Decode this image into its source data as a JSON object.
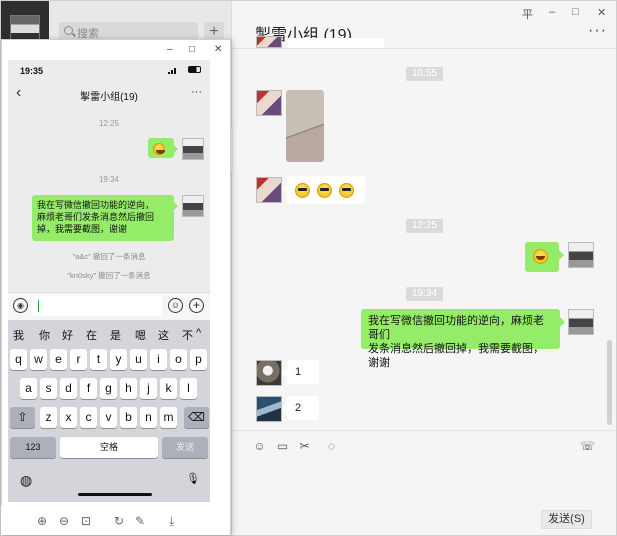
{
  "desktop": {
    "search_placeholder": "搜索",
    "add_label": "+",
    "chat_title": "掣雷小组 (19)",
    "titlebar": {
      "pin": "平",
      "min": "–",
      "max": "□",
      "close": "✕"
    },
    "more": "···",
    "times": [
      "10:55",
      "12:25",
      "19:34"
    ],
    "messages": {
      "emoji_row": "3 cool emoji",
      "right_text": "我在写微信撤回功能的逆向，麻烦老哥们发条消息然后撤回掉，我需要截图，谢谢",
      "right_line1": "我在写微信撤回功能的逆向，麻烦老哥们",
      "right_line2": "发条消息然后撤回掉，我需要截图，谢谢",
      "reply1": "1",
      "reply2": "2"
    },
    "tools": {
      "emoji": "☺",
      "folder": "▭",
      "scissors": "✂",
      "chat": "◌",
      "video": "☏"
    },
    "send_label": "发送(S)"
  },
  "phone": {
    "window_controls": {
      "min": "–",
      "max": "□",
      "close": "✕"
    },
    "status_time": "19:35",
    "back": "‹",
    "chat_title": "掣雷小组(19)",
    "more": "···",
    "time1": "12:25",
    "time2": "19:34",
    "bubble_text_line1": "我在写微信撤回功能的逆向，",
    "bubble_text_line2": "麻烦老哥们发条消息然后撤回",
    "bubble_text_line3": "掉，我需要截图，谢谢",
    "recall1": "\"a&c\" 撤回了一条消息",
    "recall2": "\"kn0sky\" 撤回了一条消息",
    "voice_icon": "◉",
    "emoji_icon": "☺",
    "plus_icon": "+",
    "candidates": [
      "我",
      "你",
      "好",
      "在",
      "是",
      "嗯",
      "这",
      "不",
      "^"
    ],
    "row1": [
      "q",
      "w",
      "e",
      "r",
      "t",
      "y",
      "u",
      "i",
      "o",
      "p"
    ],
    "row2": [
      "a",
      "s",
      "d",
      "f",
      "g",
      "h",
      "j",
      "k",
      "l"
    ],
    "row3": [
      "z",
      "x",
      "c",
      "v",
      "b",
      "n",
      "m"
    ],
    "shift": "⇧",
    "delete": "⌫",
    "num_key": "123",
    "space_key": "空格",
    "send_key": "发送",
    "globe": "◍",
    "mic": "🎙",
    "bottom_tools": [
      "⊕",
      "⊖",
      "⊡",
      "↻",
      "✎",
      "⤓"
    ]
  }
}
